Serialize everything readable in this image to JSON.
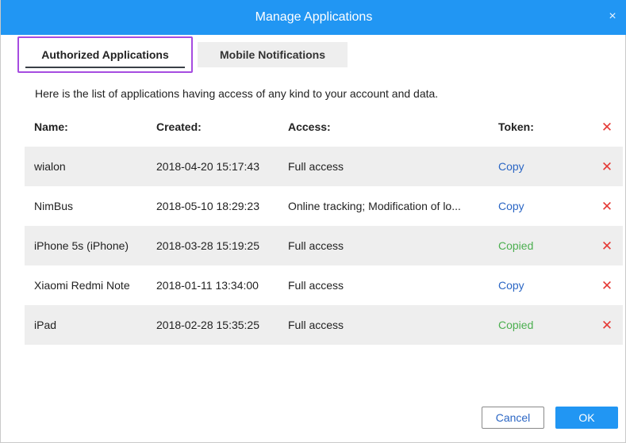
{
  "dialog": {
    "title": "Manage Applications",
    "close_glyph": "×"
  },
  "tabs": [
    {
      "label": "Authorized Applications",
      "active": true
    },
    {
      "label": "Mobile Notifications",
      "active": false
    }
  ],
  "description": "Here is the list of applications having access of any kind to your account and data.",
  "table": {
    "headers": {
      "name": "Name:",
      "created": "Created:",
      "access": "Access:",
      "token": "Token:",
      "delete": "✕"
    },
    "rows": [
      {
        "name": "wialon",
        "created": "2018-04-20 15:17:43",
        "access": "Full access",
        "token": "Copy",
        "delete": "✕"
      },
      {
        "name": "NimBus",
        "created": "2018-05-10 18:29:23",
        "access": "Online tracking; Modification of lo...",
        "token": "Copy",
        "delete": "✕"
      },
      {
        "name": "iPhone 5s (iPhone)",
        "created": "2018-03-28 15:19:25",
        "access": "Full access",
        "token": "Copied",
        "delete": "✕"
      },
      {
        "name": "Xiaomi Redmi Note",
        "created": "2018-01-11 13:34:00",
        "access": "Full access",
        "token": "Copy",
        "delete": "✕"
      },
      {
        "name": "iPad",
        "created": "2018-02-28 15:35:25",
        "access": "Full access",
        "token": "Copied",
        "delete": "✕"
      }
    ]
  },
  "footer": {
    "cancel_label": "Cancel",
    "ok_label": "OK"
  },
  "colors": {
    "accent": "#2196f3",
    "delete": "#e53935",
    "copy_link": "#2b66c4",
    "copied_link": "#4caf50",
    "tab_highlight": "#a64ce0"
  }
}
